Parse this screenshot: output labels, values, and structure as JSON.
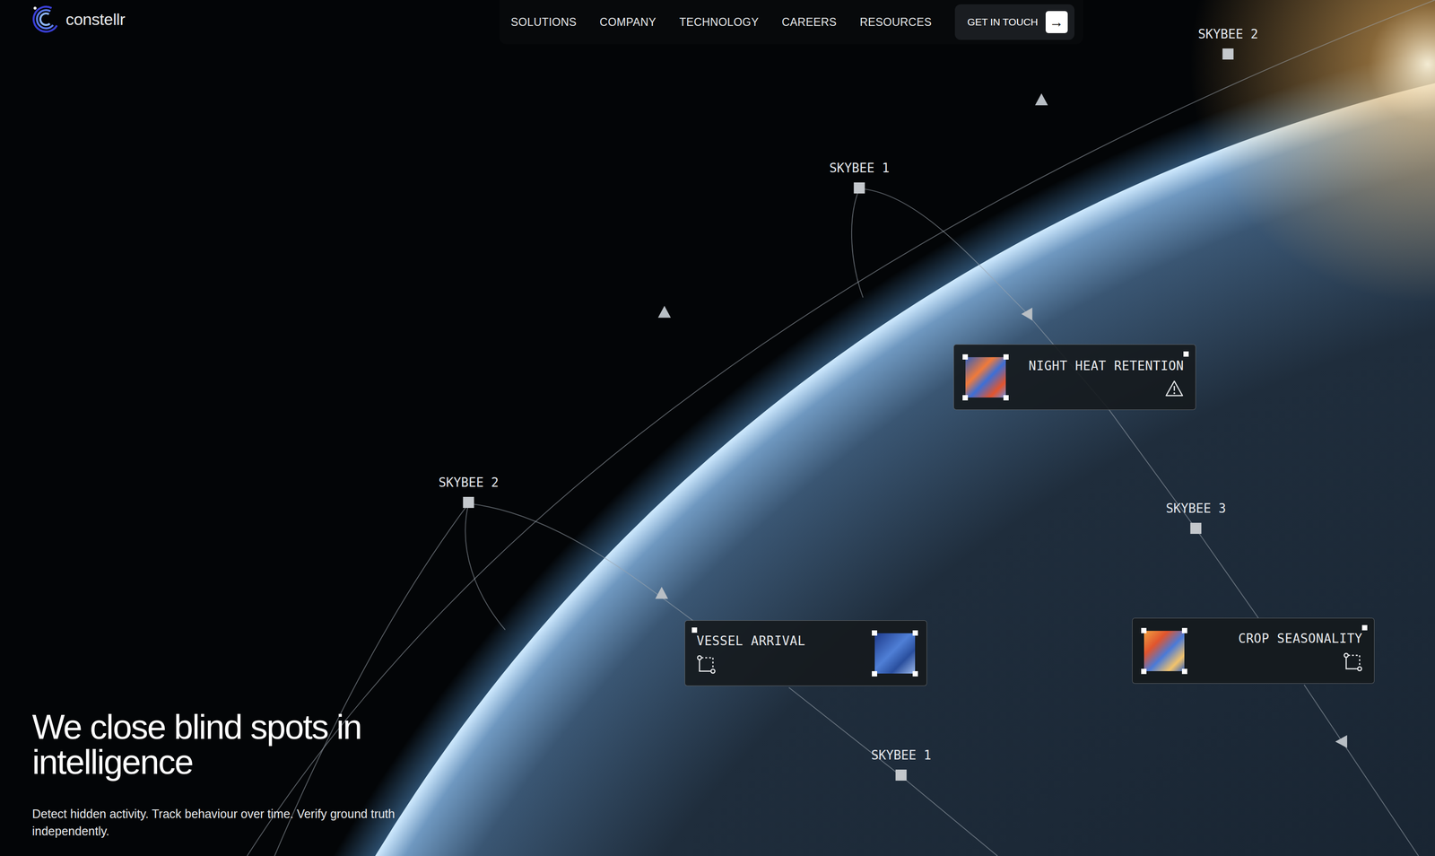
{
  "logo": {
    "text": "constellr"
  },
  "nav": [
    {
      "label": "SOLUTIONS"
    },
    {
      "label": "COMPANY"
    },
    {
      "label": "TECHNOLOGY"
    },
    {
      "label": "CAREERS"
    },
    {
      "label": "RESOURCES"
    }
  ],
  "cta": {
    "label": "GET IN TOUCH",
    "icon": "→"
  },
  "satellites": [
    {
      "label": "SKYBEE 2"
    },
    {
      "label": "SKYBEE 1"
    },
    {
      "label": "SKYBEE 2"
    },
    {
      "label": "SKYBEE 3"
    },
    {
      "label": "SKYBEE 1"
    }
  ],
  "cards": [
    {
      "label": "NIGHT HEAT RETENTION",
      "kind": "alert"
    },
    {
      "label": "VESSEL ARRIVAL",
      "kind": "trailing"
    },
    {
      "label": "CROP SEASONALITY",
      "kind": "leading"
    }
  ],
  "hero": {
    "heading": "We close blind spots in intelligence",
    "subtitle": "Detect hidden activity. Track behaviour over time. Verify ground truth independently."
  }
}
